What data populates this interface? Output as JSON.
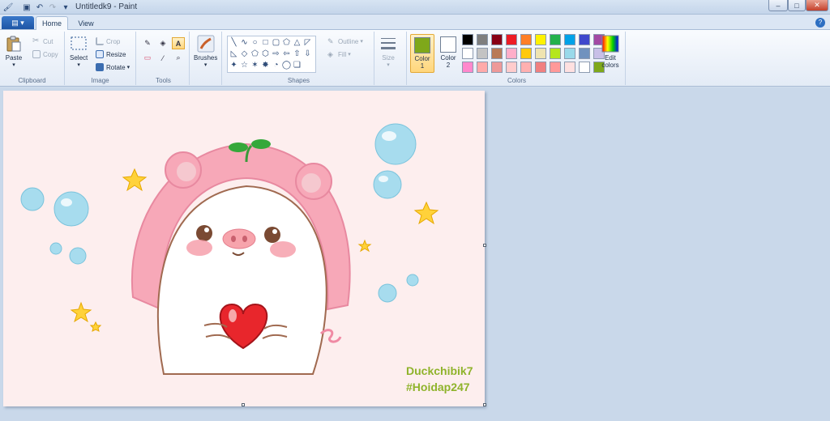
{
  "window": {
    "title": "Untitledk9 - Paint",
    "minimize_glyph": "–",
    "maximize_glyph": "□",
    "close_glyph": "✕"
  },
  "quick_access": {
    "save_glyph": "▣",
    "undo_glyph": "↶",
    "redo_glyph": "↷",
    "customize_glyph": "▾"
  },
  "tabs": {
    "app_menu_glyph": "▤ ▾",
    "home": "Home",
    "view": "View",
    "help_glyph": "?"
  },
  "ribbon": {
    "clipboard": {
      "label": "Clipboard",
      "paste": "Paste",
      "cut": "Cut",
      "copy": "Copy"
    },
    "image": {
      "label": "Image",
      "select": "Select",
      "crop": "Crop",
      "resize": "Resize",
      "rotate": "Rotate"
    },
    "tools": {
      "label": "Tools",
      "items": [
        "✎",
        "◈",
        "A",
        "▭",
        "⁄",
        "⌕"
      ]
    },
    "brushes": {
      "label": "Brushes"
    },
    "shapes": {
      "label": "Shapes",
      "items": [
        "╲",
        "∿",
        "○",
        "□",
        "▢",
        "⬠",
        "△",
        "◸",
        "◺",
        "◇",
        "⬠",
        "⬡",
        "⇨",
        "⇦",
        "⇧",
        "⇩",
        "✦",
        "☆",
        "✶",
        "✸",
        "◔",
        "◯",
        "❏",
        ""
      ],
      "outline": "Outline",
      "fill": "Fill"
    },
    "size": {
      "label": "Size"
    },
    "colors": {
      "label": "Colors",
      "color1_label": "Color\n1",
      "color2_label": "Color\n2",
      "color1": "#7fa81a",
      "color2": "#ffffff",
      "edit_colors": "Edit colors",
      "palette": [
        "#000000",
        "#7f7f7f",
        "#880015",
        "#ed1c24",
        "#ff7f27",
        "#fff200",
        "#22b14c",
        "#00a2e8",
        "#3f48cc",
        "#a349a4",
        "#ffffff",
        "#c3c3c3",
        "#b97a57",
        "#ffaec9",
        "#ffc90e",
        "#efe4b0",
        "#b5e61d",
        "#99d9ea",
        "#7092be",
        "#c8bfe7",
        "#ff88cc",
        "#ffaaaa",
        "#ee9999",
        "#ffcccc",
        "#ffb0b0",
        "#f08080",
        "#ff9999",
        "#ffe0e0",
        "#ffffff",
        "#7fa81a"
      ]
    }
  },
  "canvas": {
    "background": "#fdeeee",
    "watermark_line1": "Duckchibik7",
    "watermark_line2": "#Hoidap247",
    "watermark_color": "#8fb32b"
  }
}
